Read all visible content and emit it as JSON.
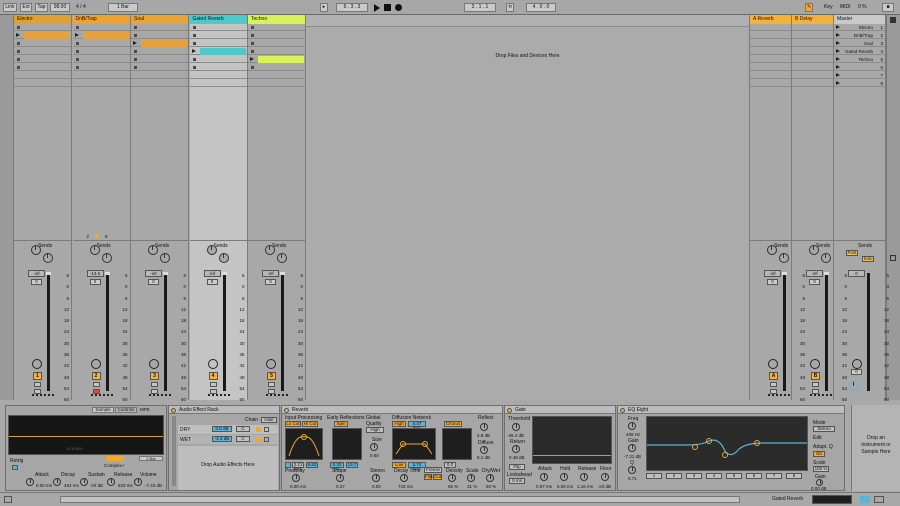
{
  "colors": {
    "electro": "#e0a133",
    "dnb": "#f0a22e",
    "soul": "#e8a437",
    "gated": "#4ec9c9",
    "techno": "#d8f25a",
    "play_clip": "#e6a23e",
    "selected_track_bg": "#c9c9c9",
    "orange_btn": "#f6b13c",
    "accent_blue": "#5bb3d6"
  },
  "topbar": {
    "link": "Link",
    "ext": "Ext",
    "tap": "Tap",
    "tempo": "98.00",
    "sig_num": "4",
    "sig_den": "4",
    "quant": "1 Bar",
    "pos": "6 . 3 . 3",
    "pos2": "3 . 1 . 1",
    "len": "4 . 0 . 0",
    "key": "Key",
    "midi": "MIDI",
    "pct": "0 %"
  },
  "tracks": [
    {
      "name": "Electro",
      "color": "#e0a133",
      "active": 1,
      "mix": {
        "vol": "-inf",
        "pan": "0",
        "num": "1"
      }
    },
    {
      "name": "DnB/Trap",
      "color": "#f0a22e",
      "active": 1,
      "mix": {
        "vol": "-13.6",
        "pan": "0",
        "num": "2"
      }
    },
    {
      "name": "Soul",
      "color": "#e8a437",
      "active": 2,
      "mix": {
        "vol": "-inf",
        "pan": "0",
        "num": "3"
      }
    },
    {
      "name": "Gated Reverb",
      "color": "#4ec9c9",
      "active": 3,
      "mix": {
        "vol": "-inf",
        "pan": "0",
        "num": "4"
      }
    },
    {
      "name": "Techno",
      "color": "#d8f25a",
      "active": 4,
      "mix": {
        "vol": "-inf",
        "pan": "0",
        "num": "5"
      }
    }
  ],
  "drop_text": "Drop Files and Devices Here",
  "sends_label": "Sends",
  "returns": [
    {
      "name": "A Reverb",
      "btn": "A",
      "vol": "-inf",
      "pan": "0"
    },
    {
      "name": "B Delay",
      "btn": "B",
      "vol": "-inf",
      "pan": "0"
    }
  ],
  "master": {
    "name": "Master",
    "vol": "0",
    "pan": "0",
    "scenes": [
      "Electro",
      "DnB/Trap",
      "Soul",
      "Gated Reverb",
      "Techno"
    ],
    "post": "Post",
    "solo": "Solo"
  },
  "track2_counter": {
    "a": "2",
    "b": "8"
  },
  "scale": [
    "6",
    "0",
    "6",
    "12",
    "18",
    "24",
    "30",
    "36",
    "42",
    "48",
    "54",
    "60"
  ],
  "devices": {
    "sampler": {
      "sample": "Sample",
      "controls": "Controls",
      "mpe": "MPE",
      "retrig": "Retrig",
      "attack_l": "Attack",
      "attack": "0.00 ms",
      "decay_l": "Decay",
      "decay": "454 ms",
      "sustain_l": "Sustain",
      "sustain": "-inf dB",
      "release_l": "Release",
      "release": "533 ms",
      "volume_l": "Volume",
      "volume": "-7.43 dB",
      "complex": "Complex+",
      "time": "0:00:000",
      "bar": "1 Bar"
    },
    "rack": {
      "title": "Audio Effect Rack",
      "chain": "Chain",
      "hide": "Hide",
      "dry": "DRY",
      "dry_v": "0.0 dB",
      "wet": "WET",
      "wet_v": "-2.4 dB",
      "c": "C",
      "drop": "Drop Audio Effects Here"
    },
    "reverb": {
      "title": "Reverb",
      "input": "Input Processing",
      "early": "Early Reflections",
      "global": "Global",
      "diffusion": "Diffusion Network",
      "lo": "Lo Cut",
      "hi": "Hi Cut",
      "spin": "Spin",
      "quality": "Quality",
      "quality_v": "High",
      "high": "High",
      "high_v": "4.47 kHz",
      "chorus": "Chorus",
      "reflect": "Reflect",
      "reflect_v": "2.9 dB",
      "diffuse": "Diffuse",
      "diffuse_v": "8.1 dB",
      "size": "Size",
      "size_v": "0.60",
      "predelay": "Predelay",
      "predelay_v": "0.00 ms",
      "shape": "Shape",
      "shape_v": "0.37",
      "stereo": "Stereo",
      "stereo_v": "0.00",
      "decay": "Decay Time",
      "decay_v": "743 ms",
      "freeze": "Freeze",
      "flat": "Flat",
      "cut": "Cut",
      "density": "Density",
      "density_v": "66 %",
      "scale": "Scale",
      "scale_v": "31 %",
      "drywet": "Dry/Wet",
      "drywet_v": "50 %",
      "low": "Low",
      "low_v": "3.74 kHz",
      "v1": "3.21 kHz",
      "v2": "6.53",
      "v3": "0.33 Hz",
      "v4": "13.7",
      "v5": "0.0"
    },
    "gate": {
      "title": "Gate",
      "threshold": "Threshold",
      "threshold_v": "-26.4 dB",
      "return": "Return",
      "return_v": "0.48 dB",
      "flip": "Flip",
      "lookahead": "Lookahead",
      "lookahead_v": "0 ms",
      "attack": "Attack",
      "attack_v": "0.97 ms",
      "hold": "Hold",
      "hold_v": "5.00 ms",
      "release": "Release",
      "release_v": "1.16 ms",
      "floor": "Floor",
      "floor_v": "-inf dB",
      "ticks": [
        "-6",
        "-12",
        "-18",
        "-24",
        "-30",
        "-36"
      ]
    },
    "eq": {
      "title": "EQ Eight",
      "freq": "Freq",
      "freq_v": "408 Hz",
      "gain": "Gain",
      "gain_v": "-7.31 dB",
      "q": "Q",
      "q_v": "0.71",
      "mode": "Mode",
      "mode_v": "Stereo",
      "edit": "Edit",
      "adapt": "Adapt. Q",
      "on": "On",
      "scale": "Scale",
      "scale_v": "100 %",
      "out": "Gain",
      "out_v": "0.00 dB",
      "x_ticks": [
        "100",
        "1k",
        "10k"
      ],
      "y_ticks": [
        "12",
        "6",
        "0",
        "-6",
        "-12"
      ]
    }
  },
  "rightpanel": {
    "text": "Drop an Instrument or Sample Here"
  },
  "status": {
    "track": "Gated Reverb"
  }
}
